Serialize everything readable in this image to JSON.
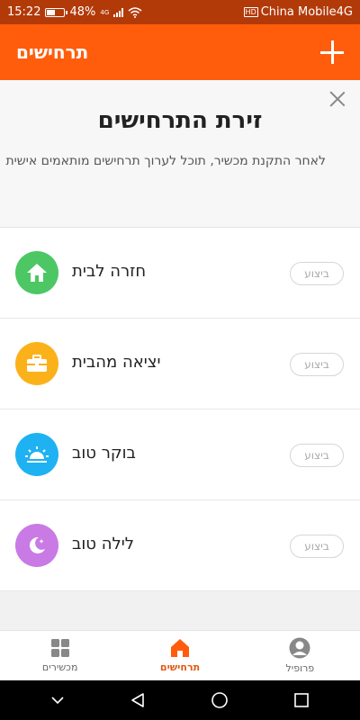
{
  "status_bar": {
    "time": "15:22",
    "battery": "48%",
    "battery_level": 0.48,
    "network": "4G",
    "carrier": "China Mobile4G",
    "hd_badge": "HD"
  },
  "app_bar": {
    "title": "תרחישים",
    "add_icon": "plus-icon"
  },
  "promo": {
    "title": "זירת התרחישים",
    "subtitle": "לאחר התקנת מכשיר, תוכל לערוך תרחישים מותאמים אישית",
    "close_icon": "close-icon"
  },
  "scenes": [
    {
      "label": "חזרה לבית",
      "action": "ביצוע",
      "icon": "home-icon",
      "color": "#4cc764"
    },
    {
      "label": "יציאה מהבית",
      "action": "ביצוע",
      "icon": "briefcase-icon",
      "color": "#fbb21a"
    },
    {
      "label": "בוקר טוב",
      "action": "ביצוע",
      "icon": "sunrise-icon",
      "color": "#1fb2f2"
    },
    {
      "label": "לילה טוב",
      "action": "ביצוע",
      "icon": "moon-icon",
      "color": "#c97ae5"
    }
  ],
  "bottom_nav": [
    {
      "label": "מכשירים",
      "icon": "grid-icon",
      "active": false
    },
    {
      "label": "תרחישים",
      "icon": "home-icon",
      "active": true
    },
    {
      "label": "פרופיל",
      "icon": "user-icon",
      "active": false
    }
  ],
  "colors": {
    "accent": "#ff5d0c",
    "status_bar": "#b23a09",
    "active_tab": "#e05a14"
  }
}
